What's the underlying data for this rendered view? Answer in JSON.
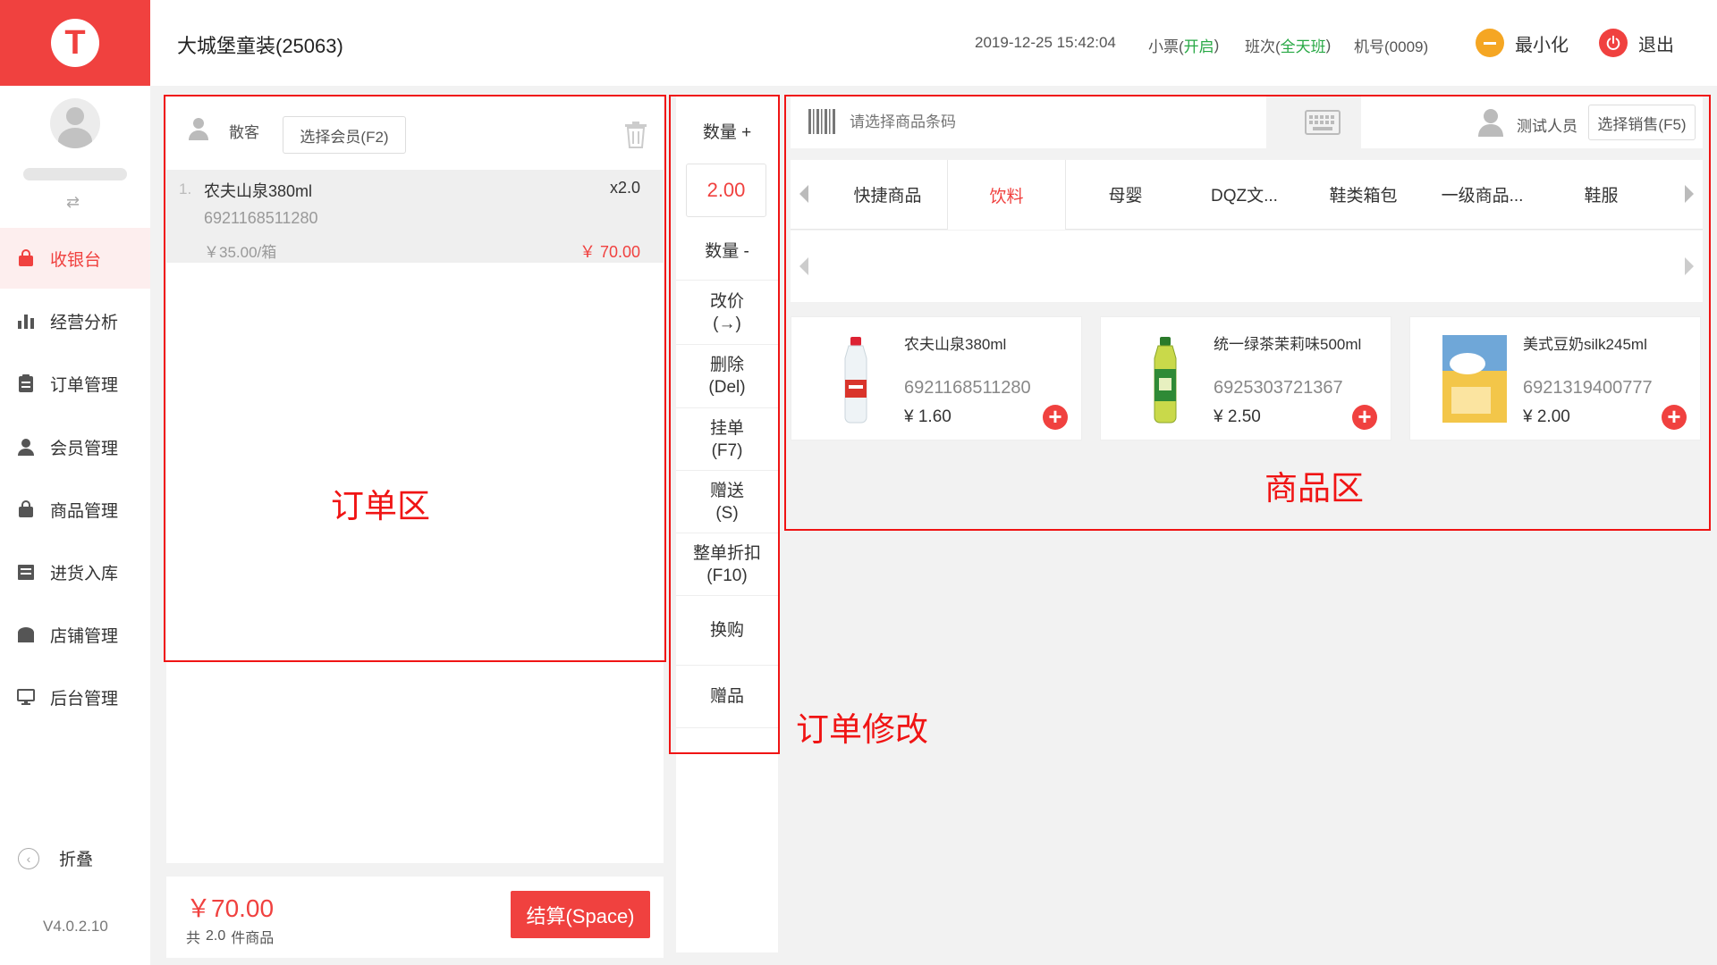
{
  "header": {
    "logo_letter": "T",
    "store_name": "大城堡童装(25063)",
    "datetime": "2019-12-25 15:42:04",
    "receipt_label": "小票(",
    "receipt_status": "开启",
    "receipt_close": ")",
    "shift_label": "班次(",
    "shift_value": "全天班",
    "shift_close": ")",
    "machine": "机号(0009)",
    "minimize_label": "最小化",
    "exit_label": "退出"
  },
  "sidebar": {
    "switch_glyph": "⇄",
    "items": [
      {
        "label": "收银台",
        "icon": "bag-icon"
      },
      {
        "label": "经营分析",
        "icon": "bar-chart-icon"
      },
      {
        "label": "订单管理",
        "icon": "clipboard-icon"
      },
      {
        "label": "会员管理",
        "icon": "user-icon"
      },
      {
        "label": "商品管理",
        "icon": "bag-outline-icon"
      },
      {
        "label": "进货入库",
        "icon": "inbox-icon"
      },
      {
        "label": "店铺管理",
        "icon": "store-icon"
      },
      {
        "label": "后台管理",
        "icon": "monitor-icon"
      }
    ],
    "collapse_label": "折叠",
    "version": "V4.0.2.10"
  },
  "order": {
    "customer_label": "散客",
    "select_member_label": "选择会员(F2)",
    "items": [
      {
        "index": "1.",
        "name": "农夫山泉380ml",
        "qty": "x2.0",
        "barcode": "6921168511280",
        "unit_price": "￥35.00/箱",
        "subtotal": "￥ 70.00"
      }
    ],
    "total": "￥70.00",
    "count_prefix": "共",
    "count_value": "2.0",
    "count_suffix": "件商品",
    "checkout_label": "结算(Space)"
  },
  "ops": {
    "qty_plus": "数量 +",
    "qty_value": "2.00",
    "qty_minus": "数量 -",
    "buttons": [
      {
        "line1": "改价",
        "line2": "(→)"
      },
      {
        "line1": "删除",
        "line2": "(Del)"
      },
      {
        "line1": "挂单",
        "line2": "(F7)"
      },
      {
        "line1": "赠送",
        "line2": "(S)"
      },
      {
        "line1": "整单折扣",
        "line2": "(F10)"
      },
      {
        "line1": "换购",
        "line2": ""
      },
      {
        "line1": "赠品",
        "line2": ""
      }
    ]
  },
  "products": {
    "barcode_placeholder": "请选择商品条码",
    "staff_name": "测试人员",
    "select_sales_label": "选择销售(F5)",
    "tabs": [
      "快捷商品",
      "饮料",
      "母婴",
      "DQZ文...",
      "鞋类箱包",
      "一级商品...",
      "鞋服"
    ],
    "active_tab": 1,
    "cards": [
      {
        "name": "农夫山泉380ml",
        "barcode": "6921168511280",
        "price": "¥ 1.60",
        "image": "water-bottle"
      },
      {
        "name": "统一绿茶茉莉味500ml",
        "barcode": "6925303721367",
        "price": "¥ 2.50",
        "image": "green-tea-bottle"
      },
      {
        "name": "美式豆奶silk245ml",
        "barcode": "6921319400777",
        "price": "¥ 2.00",
        "image": "soy-milk-carton"
      }
    ]
  },
  "annotations": {
    "order_area": "订单区",
    "order_modify": "订单修改",
    "product_area": "商品区"
  },
  "colors": {
    "accent": "#f0413f",
    "status_green": "#27a844",
    "minimize_orange": "#f5a623"
  }
}
